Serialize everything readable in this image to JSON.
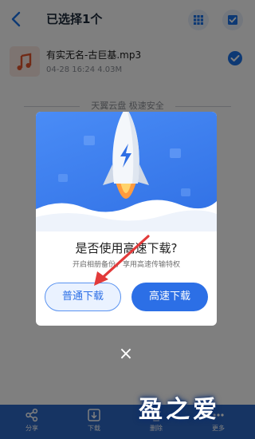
{
  "header": {
    "title": "已选择1个"
  },
  "file": {
    "name": "有实无名-古巨基.mp3",
    "meta": "04-28 16:24  4.03M"
  },
  "brand_caption": "天翼云盘 极速安全",
  "dialog": {
    "title": "是否使用高速下载?",
    "description": "开启相册备份，享用高速传输特权",
    "normal_button": "普通下载",
    "fast_button": "高速下载"
  },
  "close_label": "×",
  "bottom_tabs": [
    {
      "label": "分享",
      "icon": "share-icon"
    },
    {
      "label": "下载",
      "icon": "download-icon"
    },
    {
      "label": "删除",
      "icon": "delete-icon"
    },
    {
      "label": "更多",
      "icon": "more-icon"
    }
  ],
  "watermark": "盈之爱",
  "colors": {
    "accent": "#2c6fe6",
    "bottom_bar": "#2c68c6",
    "annotation_arrow": "#e23a3a"
  }
}
